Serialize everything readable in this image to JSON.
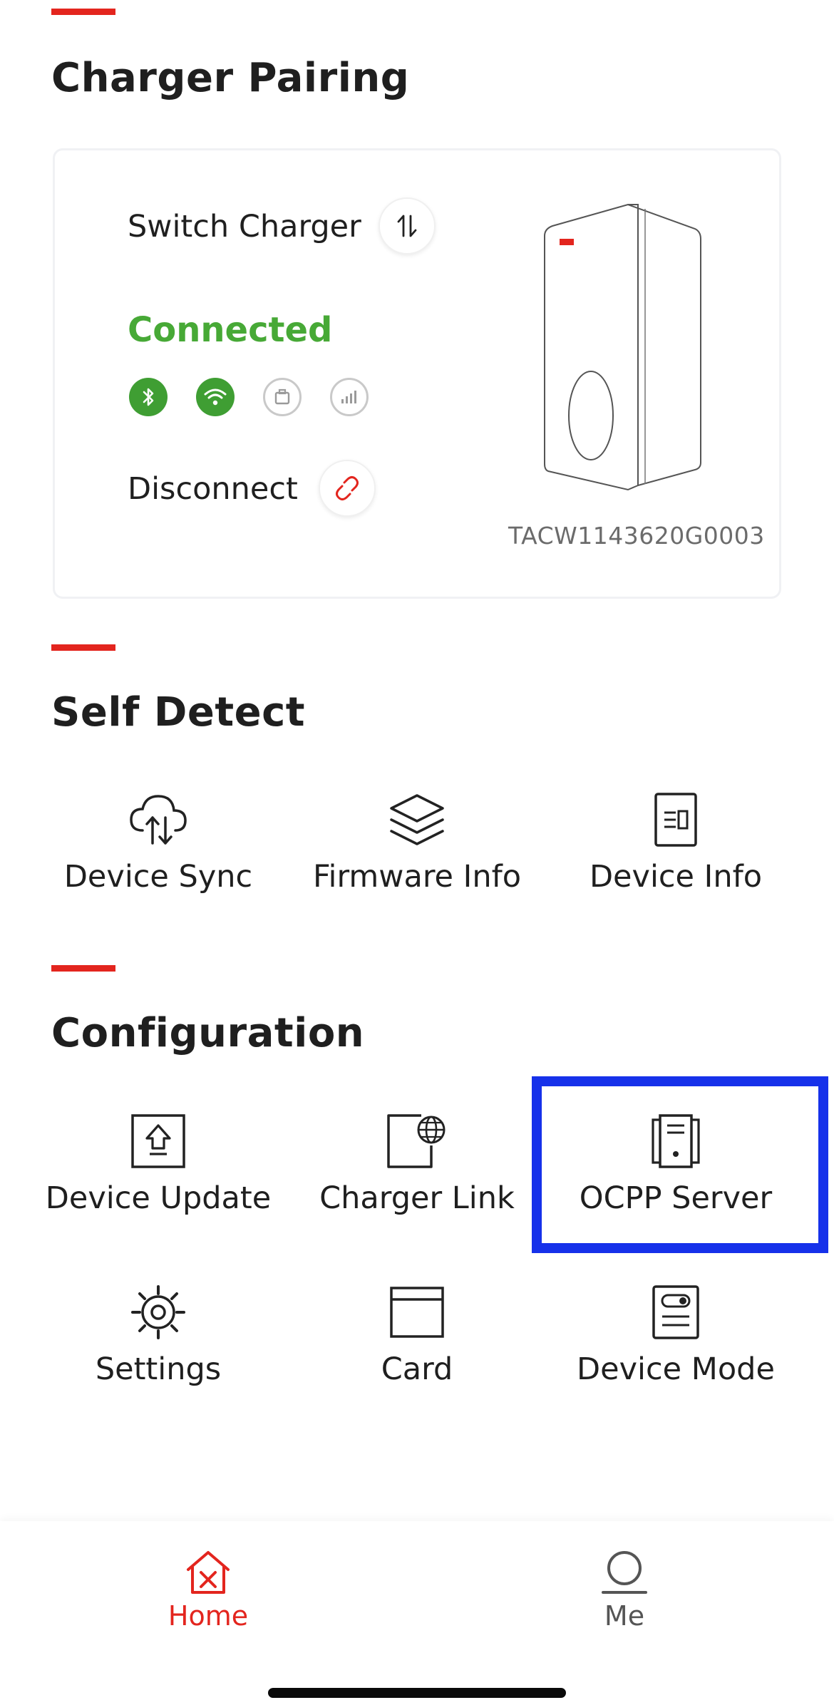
{
  "sections": {
    "pairing_title": "Charger Pairing",
    "self_detect_title": "Self Detect",
    "configuration_title": "Configuration"
  },
  "pairing": {
    "switch_label": "Switch Charger",
    "status": "Connected",
    "disconnect_label": "Disconnect",
    "serial": "TACW1143620G0003",
    "connectivity": [
      {
        "name": "bluetooth",
        "active": true
      },
      {
        "name": "wifi",
        "active": true
      },
      {
        "name": "ethernet",
        "active": false
      },
      {
        "name": "cellular",
        "active": false
      }
    ]
  },
  "self_detect": {
    "items": [
      {
        "label": "Device Sync",
        "icon": "cloud-sync-icon"
      },
      {
        "label": "Firmware Info",
        "icon": "layers-icon"
      },
      {
        "label": "Device Info",
        "icon": "document-icon"
      }
    ]
  },
  "configuration": {
    "items": [
      {
        "label": "Device Update",
        "icon": "upload-box-icon"
      },
      {
        "label": "Charger Link",
        "icon": "globe-link-icon"
      },
      {
        "label": "OCPP Server",
        "icon": "server-icon"
      },
      {
        "label": "Settings",
        "icon": "gear-icon"
      },
      {
        "label": "Card",
        "icon": "card-icon"
      },
      {
        "label": "Device Mode",
        "icon": "device-mode-icon"
      }
    ]
  },
  "tabs": {
    "home": "Home",
    "me": "Me"
  },
  "colors": {
    "accent": "#e3251e",
    "connected": "#47a936",
    "highlight": "#1631ea"
  }
}
